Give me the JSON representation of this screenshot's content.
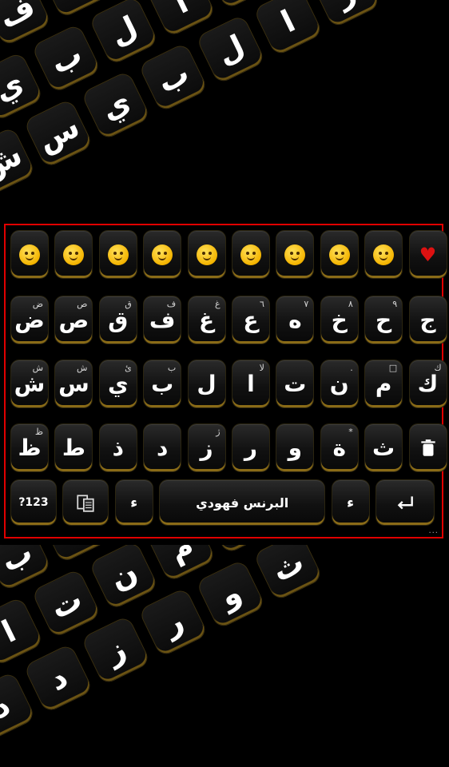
{
  "keyboard": {
    "emoji_row": [
      {
        "name": "emoji-tears-of-joy",
        "kind": "emoji"
      },
      {
        "name": "emoji-sleeping",
        "kind": "emoji"
      },
      {
        "name": "emoji-unamused",
        "kind": "emoji"
      },
      {
        "name": "emoji-flushed",
        "kind": "emoji"
      },
      {
        "name": "emoji-relieved",
        "kind": "emoji"
      },
      {
        "name": "emoji-slight-smile",
        "kind": "emoji"
      },
      {
        "name": "emoji-smiling-blush",
        "kind": "emoji"
      },
      {
        "name": "emoji-heart-eyes-cat",
        "kind": "emoji"
      },
      {
        "name": "emoji-joy-cat",
        "kind": "emoji"
      },
      {
        "name": "emoji-broken-heart",
        "kind": "heart"
      }
    ],
    "row1": [
      {
        "label": "ض",
        "sub": "ض"
      },
      {
        "label": "ص",
        "sub": "ص"
      },
      {
        "label": "ق",
        "sub": "ق"
      },
      {
        "label": "ف",
        "sub": "ف"
      },
      {
        "label": "غ",
        "sub": "غ"
      },
      {
        "label": "ع",
        "sub": "٦"
      },
      {
        "label": "ه",
        "sub": "٧"
      },
      {
        "label": "خ",
        "sub": "٨"
      },
      {
        "label": "ح",
        "sub": "٩"
      },
      {
        "label": "ج",
        "sub": ""
      }
    ],
    "row2": [
      {
        "label": "ش",
        "sub": "ش"
      },
      {
        "label": "س",
        "sub": "ش"
      },
      {
        "label": "ي",
        "sub": "ئ"
      },
      {
        "label": "ب",
        "sub": "ب"
      },
      {
        "label": "ل",
        "sub": ""
      },
      {
        "label": "ا",
        "sub": "لا"
      },
      {
        "label": "ت",
        "sub": ""
      },
      {
        "label": "ن",
        "sub": "."
      },
      {
        "label": "م",
        "sub": "□"
      },
      {
        "label": "ك",
        "sub": "ك"
      }
    ],
    "row3": [
      {
        "label": "ظ",
        "sub": "ظ"
      },
      {
        "label": "ط",
        "sub": ""
      },
      {
        "label": "ذ",
        "sub": ""
      },
      {
        "label": "د",
        "sub": ""
      },
      {
        "label": "ز",
        "sub": "ژ"
      },
      {
        "label": "ر",
        "sub": ""
      },
      {
        "label": "و",
        "sub": ""
      },
      {
        "label": "ة",
        "sub": "*"
      },
      {
        "label": "ث",
        "sub": ""
      }
    ],
    "bottom": {
      "numbers_label": "?123",
      "space_label": "البرنس فهودي",
      "hamza_label": "ء",
      "hamza_alt_label": "ء"
    }
  },
  "background_keys": {
    "top_rows": [
      [
        "ض",
        "ق",
        "ف",
        "غ",
        "ع",
        "ه",
        "خ",
        "ح",
        "م"
      ],
      [
        "س",
        "ي",
        "ب",
        "ل",
        "ا",
        "ت",
        "ن",
        "ة"
      ],
      [
        "ش",
        "س",
        "ي",
        "ب",
        "ل",
        "ا",
        "ر",
        "و"
      ]
    ],
    "bottom_rows": [
      [
        "س",
        "ي",
        "ب",
        "غ",
        "ع",
        "ه",
        "خ",
        "ح"
      ],
      [
        "ل",
        "ا",
        "ت",
        "ن",
        "م",
        "ك"
      ],
      [
        "ذ",
        "د",
        "ز",
        "ر",
        "و",
        "ث"
      ]
    ]
  }
}
